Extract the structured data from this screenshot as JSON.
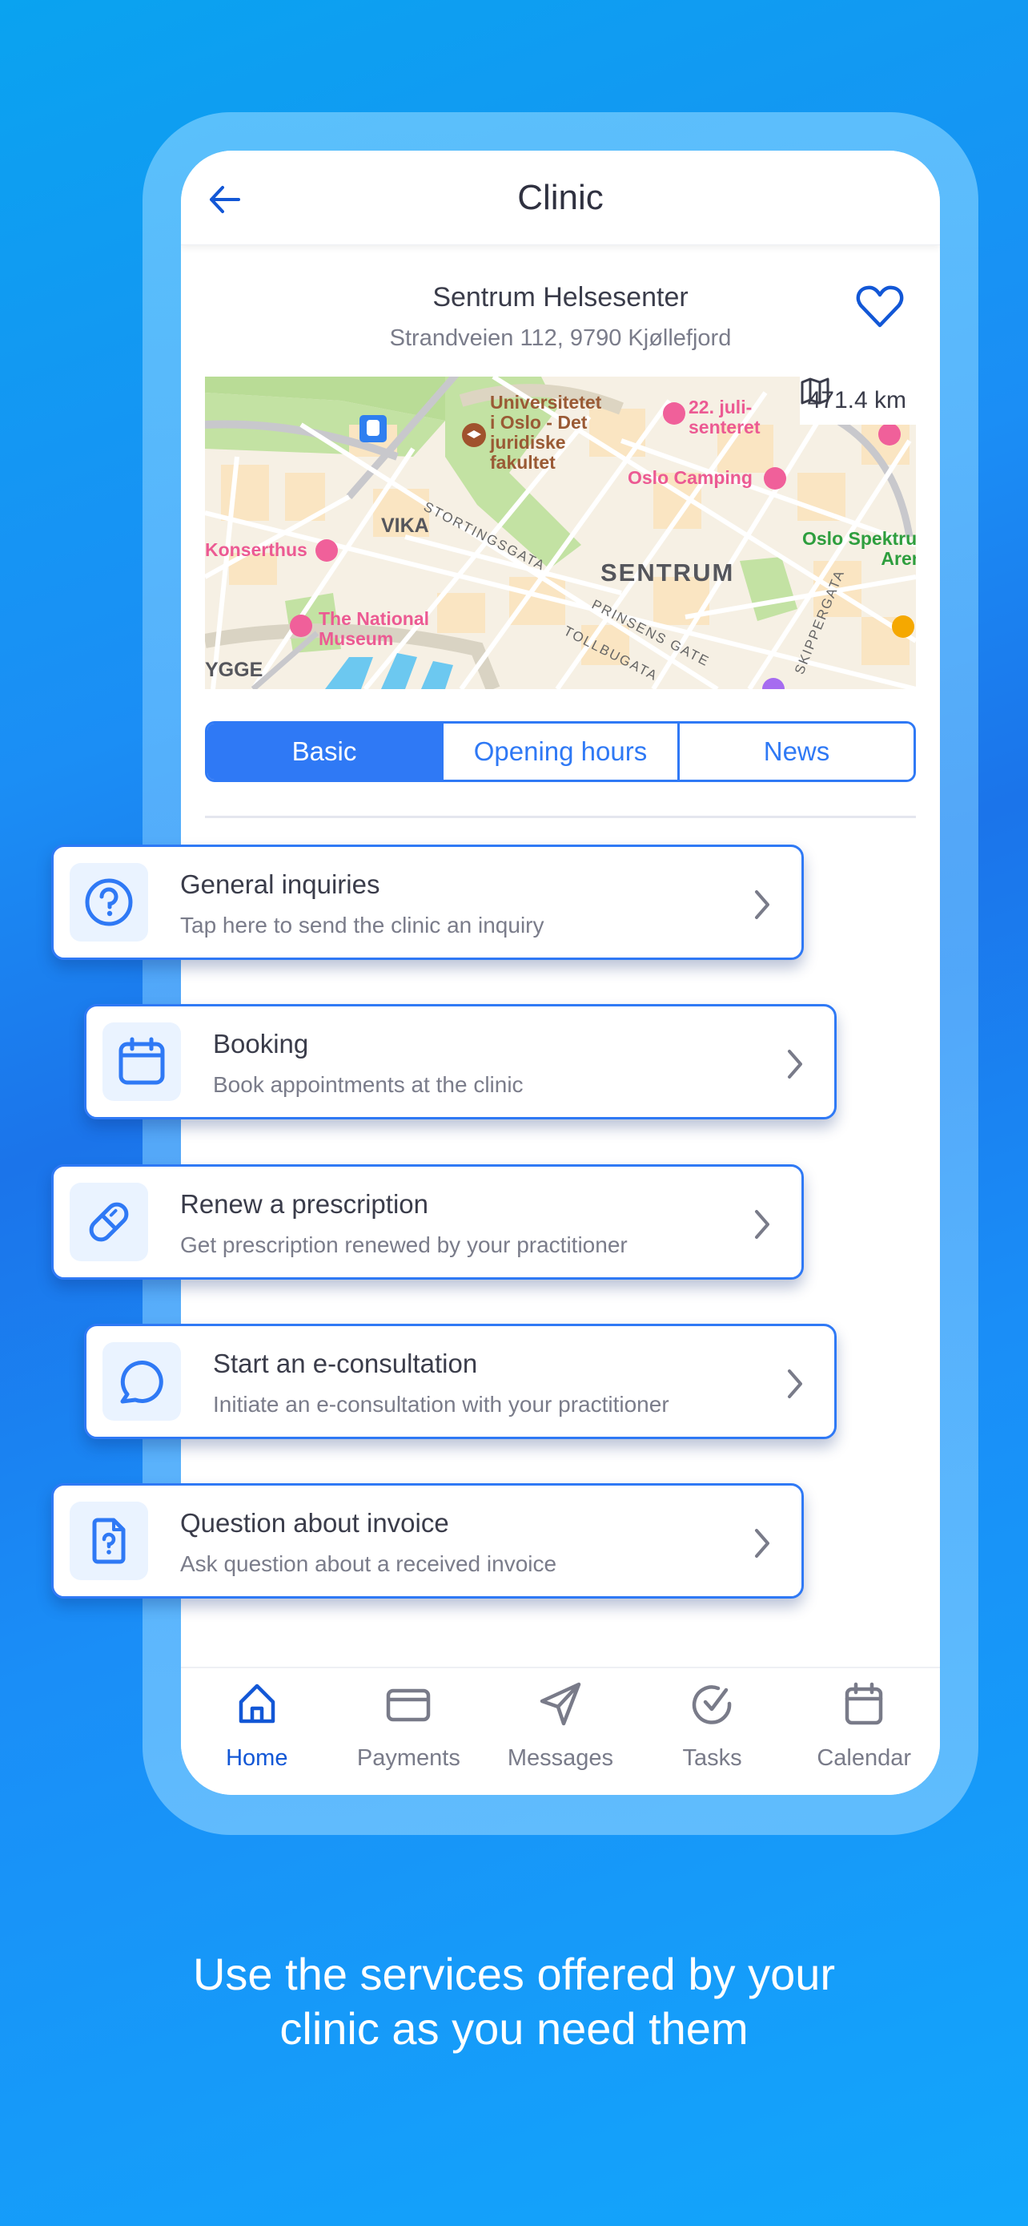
{
  "colors": {
    "accent": "#2f79f5",
    "accent_dark": "#1257d6",
    "text_primary": "#3a3c4a",
    "text_secondary": "#7a7c8a",
    "icon_bg": "#eaf3ff"
  },
  "header": {
    "back_icon": "arrow-left-icon",
    "title": "Clinic"
  },
  "clinic": {
    "name": "Sentrum Helsesenter",
    "address": "Strandveien 112, 9790 Kjøllefjord",
    "favorite_icon": "heart-outline-icon"
  },
  "map": {
    "distance": "471.4 km",
    "distance_icon": "map-icon",
    "labels": {
      "university": "Universitetet\ni Oslo - Det\njuridiske\nfakultet",
      "juli": "22. juli-\nsenteret",
      "camping": "Oslo Camping",
      "vika": "VIKA",
      "konserthus": "Konserthus",
      "sentrum": "SENTRUM",
      "spektrum": "Oslo Spektrum\nArena",
      "national_museum": "The National\nMuseum",
      "stortingsgata": "STORTINGSGATA",
      "prinsens_gate": "PRINSENS GATE",
      "tollbugata": "TOLLBUGATA",
      "skippergata": "SKIPPERGATA",
      "ygge": "YGGE"
    }
  },
  "tabs": [
    {
      "label": "Basic",
      "active": true
    },
    {
      "label": "Opening hours",
      "active": false
    },
    {
      "label": "News",
      "active": false
    }
  ],
  "services": [
    {
      "title": "General inquiries",
      "subtitle": "Tap here to send the clinic an inquiry",
      "icon": "help-circle-icon"
    },
    {
      "title": "Booking",
      "subtitle": "Book appointments at the clinic",
      "icon": "calendar-icon"
    },
    {
      "title": "Renew a prescription",
      "subtitle": "Get prescription renewed by your practitioner",
      "icon": "pill-icon"
    },
    {
      "title": "Start an e-consultation",
      "subtitle": "Initiate an e-consultation with your practitioner",
      "icon": "chat-bubble-icon"
    },
    {
      "title": "Question about invoice",
      "subtitle": "Ask question about a received invoice",
      "icon": "file-question-icon"
    }
  ],
  "bottom_nav": [
    {
      "label": "Home",
      "icon": "home-icon",
      "active": true
    },
    {
      "label": "Payments",
      "icon": "credit-card-icon",
      "active": false
    },
    {
      "label": "Messages",
      "icon": "send-icon",
      "active": false
    },
    {
      "label": "Tasks",
      "icon": "check-circle-icon",
      "active": false
    },
    {
      "label": "Calendar",
      "icon": "calendar-icon",
      "active": false
    }
  ],
  "tagline": "Use the services offered by your\nclinic as you need them"
}
